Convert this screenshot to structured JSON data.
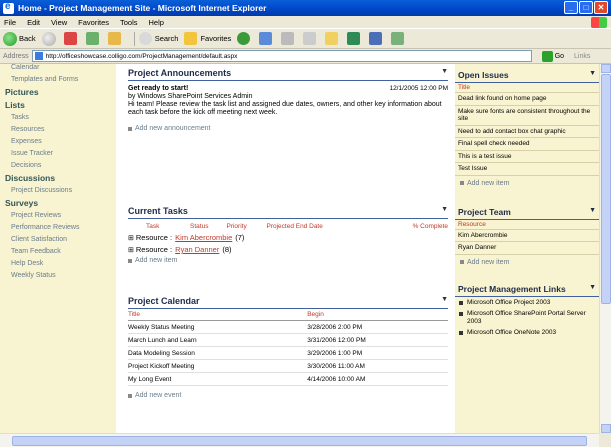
{
  "window": {
    "title": "Home - Project Management Site - Microsoft Internet Explorer"
  },
  "menu": [
    "File",
    "Edit",
    "View",
    "Favorites",
    "Tools",
    "Help"
  ],
  "toolbar": {
    "back_label": "Back",
    "search_label": "Search",
    "favorites_label": "Favorites"
  },
  "address": {
    "label": "Address",
    "url": "http://officeshowcase.colligo.com/ProjectManagement/default.aspx",
    "go_label": "Go",
    "links_label": "Links"
  },
  "leftnav": {
    "top_items": [
      "Calendar",
      "Templates and Forms"
    ],
    "sections": [
      {
        "head": "Pictures",
        "items": []
      },
      {
        "head": "Lists",
        "items": [
          "Tasks",
          "Resources",
          "Expenses",
          "Issue Tracker",
          "Decisions"
        ]
      },
      {
        "head": "Discussions",
        "items": [
          "Project Discussions"
        ]
      },
      {
        "head": "Surveys",
        "items": [
          "Project Reviews",
          "Performance Reviews",
          "Client Satisfaction",
          "Team Feedback",
          "Help Desk",
          "Weekly Status"
        ]
      }
    ]
  },
  "announcements": {
    "title": "Project Announcements",
    "item_title": "Get ready to start!",
    "date": "12/1/2005 12:00 PM",
    "by": "by Windows SharePoint Services Admin",
    "body": "Hi team! Please review the task list and assigned due dates, owners, and other key information about each task before the kick off meeting next week.",
    "add_label": "Add new announcement"
  },
  "tasks": {
    "title": "Current Tasks",
    "headers": [
      "Task",
      "Status",
      "Priority",
      "Projected End Date",
      "% Complete"
    ],
    "groups": [
      {
        "prefix": "Resource :",
        "name": "Kim Abercrombie",
        "count": "(7)"
      },
      {
        "prefix": "Resource :",
        "name": "Ryan Danner",
        "count": "(8)"
      }
    ],
    "add_label": "Add new item"
  },
  "calendar": {
    "title": "Project Calendar",
    "headers": [
      "Title",
      "Begin"
    ],
    "rows": [
      {
        "title": "Weekly Status Meeting",
        "begin": "3/28/2006 2:00 PM"
      },
      {
        "title": "March Lunch and Learn",
        "begin": "3/31/2006 12:00 PM"
      },
      {
        "title": "Data Modeling Session",
        "begin": "3/29/2006 1:00 PM"
      },
      {
        "title": "Project Kickoff Meeting",
        "begin": "3/30/2006 11:00 AM"
      },
      {
        "title": "My Long Event",
        "begin": "4/14/2006 10:00 AM"
      }
    ],
    "add_label": "Add new event"
  },
  "issues": {
    "title": "Open Issues",
    "col": "Title",
    "items": [
      "Dead link found on home page",
      "Make sure fonts are consistent throughout the site",
      "Need to add contact box chat graphic",
      "Final spell check needed",
      "This is a test issue",
      "Test Issue"
    ],
    "add_label": "Add new item"
  },
  "team": {
    "title": "Project Team",
    "col": "Resource",
    "items": [
      "Kim Abercrombie",
      "Ryan Danner"
    ],
    "add_label": "Add new item"
  },
  "links": {
    "title": "Project Management Links",
    "items": [
      "Microsoft Office Project 2003",
      "Microsoft Office SharePoint Portal Server 2003",
      "Microsoft Office OneNote 2003"
    ]
  },
  "colors": {
    "titlebar": "#0a5fd8",
    "nav_bg": "#f8f3d0",
    "accent_link": "#c0392b"
  }
}
